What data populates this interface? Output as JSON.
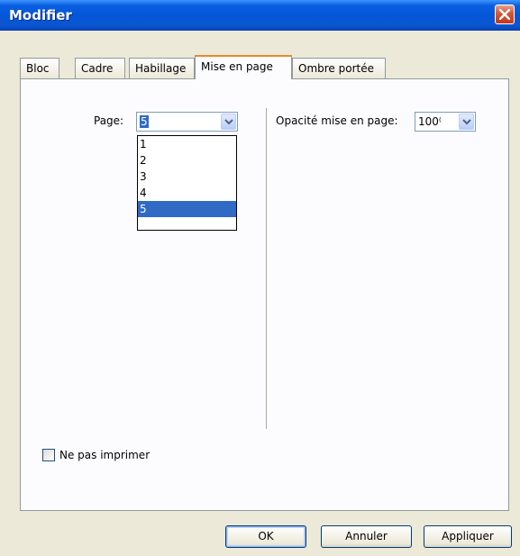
{
  "window": {
    "title": "Modifier"
  },
  "tabs": [
    {
      "label": "Bloc"
    },
    {
      "label": "Cadre"
    },
    {
      "label": "Habillage"
    },
    {
      "label": "Mise en page"
    },
    {
      "label": "Ombre portée"
    }
  ],
  "active_tab": "Mise en page",
  "page_field": {
    "label": "Page:",
    "value": "5",
    "options": [
      "1",
      "2",
      "3",
      "4",
      "5"
    ],
    "selected": "5"
  },
  "opacity_field": {
    "label": "Opacité mise en page:",
    "value": "100⁽"
  },
  "no_print": {
    "label": "Ne pas imprimer",
    "checked": false
  },
  "buttons": {
    "ok": "OK",
    "cancel": "Annuler",
    "apply": "Appliquer"
  },
  "colors": {
    "titlebar": "#0456d8",
    "selection": "#316ac5",
    "active_tab_accent": "#e68b2c",
    "close": "#c0391c"
  }
}
